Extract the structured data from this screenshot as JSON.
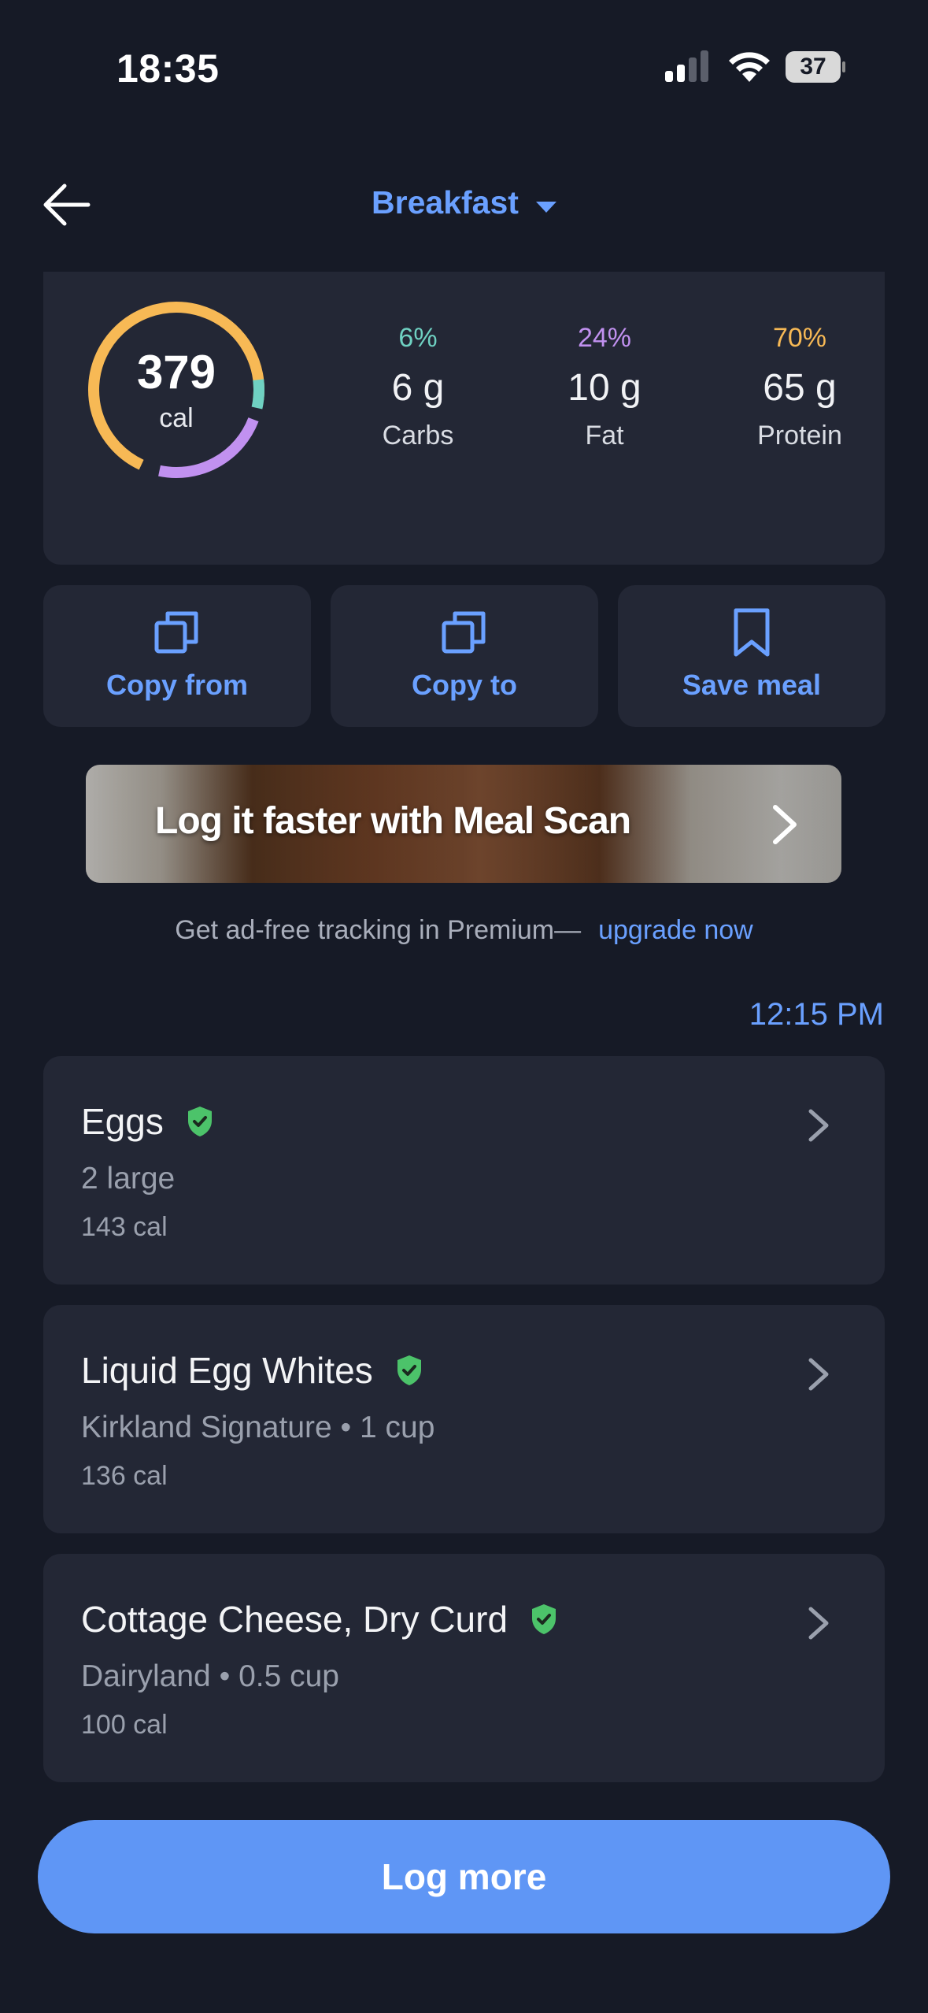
{
  "status_bar": {
    "time": "18:35",
    "battery": "37"
  },
  "nav": {
    "title": "Breakfast"
  },
  "summary": {
    "calories": "379",
    "calories_unit": "cal",
    "macros": [
      {
        "pct": "6%",
        "grams": "6 g",
        "label": "Carbs",
        "color": "#6fd1c2"
      },
      {
        "pct": "24%",
        "grams": "10 g",
        "label": "Fat",
        "color": "#c191f0"
      },
      {
        "pct": "70%",
        "grams": "65 g",
        "label": "Protein",
        "color": "#f7b955"
      }
    ]
  },
  "actions": [
    {
      "label": "Copy from",
      "icon": "copy-icon"
    },
    {
      "label": "Copy to",
      "icon": "copy-icon"
    },
    {
      "label": "Save meal",
      "icon": "bookmark-icon"
    }
  ],
  "banner": {
    "text": "Log it faster with Meal Scan"
  },
  "premium": {
    "text": "Get ad-free tracking in Premium—",
    "link": "upgrade now"
  },
  "meal_time": "12:15 PM",
  "foods": [
    {
      "name": "Eggs",
      "detail": "2 large",
      "calories": "143 cal"
    },
    {
      "name": "Liquid Egg Whites",
      "detail": "Kirkland Signature • 1 cup",
      "calories": "136 cal"
    },
    {
      "name": "Cottage Cheese, Dry Curd",
      "detail": "Dairyland • 0.5 cup",
      "calories": "100 cal"
    }
  ],
  "log_more_label": "Log more",
  "colors": {
    "accent": "#6aa0ff",
    "background": "#161a26",
    "card": "#232735",
    "verified": "#4cc36a"
  }
}
